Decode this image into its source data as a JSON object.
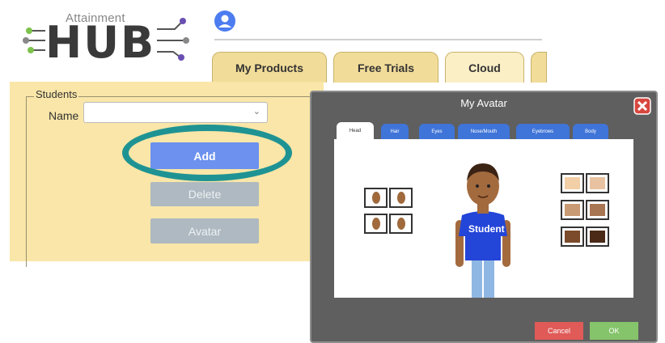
{
  "header": {
    "logo_small": "Attainment",
    "logo_big": "HUB",
    "tabs": [
      {
        "label": "My Products"
      },
      {
        "label": "Free Trials"
      },
      {
        "label": "Cloud"
      }
    ]
  },
  "students": {
    "legend": "Students",
    "name_label": "Name",
    "name_value": "",
    "add_label": "Add",
    "delete_label": "Delete",
    "avatar_label": "Avatar"
  },
  "dialog": {
    "title": "My Avatar",
    "tabs": [
      "Head",
      "Hair",
      "Eyes",
      "Nose/Mouth",
      "Eyebrows",
      "Body"
    ],
    "shirt_text": "Student",
    "cancel_label": "Cancel",
    "ok_label": "OK",
    "skin_colors": [
      "#f2cfa6",
      "#e9c3a1",
      "#c99b74",
      "#a87652",
      "#7c4b2b",
      "#4b2a17"
    ]
  },
  "colors": {
    "panel": "#f9e6a8",
    "add_button": "#6c91ee",
    "highlight_ring": "#1f9393"
  }
}
